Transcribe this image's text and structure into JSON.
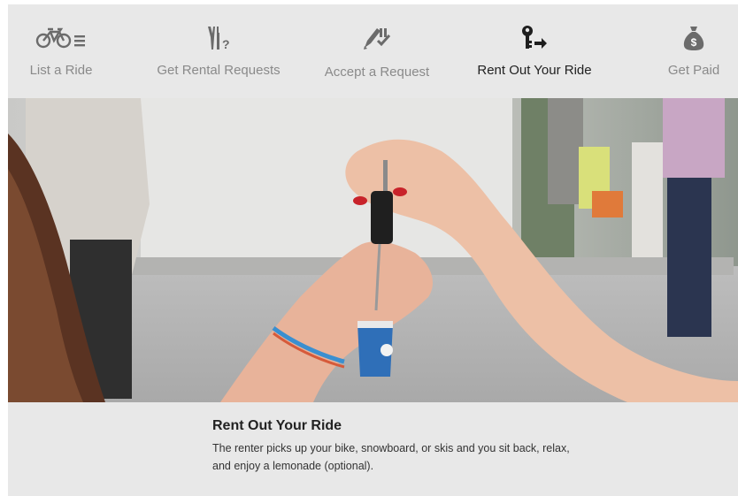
{
  "steps": [
    {
      "label": "List a Ride",
      "icon": "bicycle-list-icon",
      "active": false
    },
    {
      "label": "Get Rental Requests",
      "icon": "tools-question-icon",
      "active": false
    },
    {
      "label": "Accept a Request",
      "icon": "pen-check-icon",
      "active": false
    },
    {
      "label": "Rent Out Your Ride",
      "icon": "key-arrow-icon",
      "active": true
    },
    {
      "label": "Get Paid",
      "icon": "money-bag-icon",
      "active": false
    }
  ],
  "hero": {
    "description": "photo"
  },
  "caption": {
    "title": "Rent Out Your Ride",
    "body": "The renter picks up your bike, snowboard, or skis and you sit back, relax, and enjoy a lemonade (optional)."
  },
  "colors": {
    "background": "#e8e8e8",
    "text_active": "#222222",
    "text_inactive": "#8a8a8a"
  }
}
